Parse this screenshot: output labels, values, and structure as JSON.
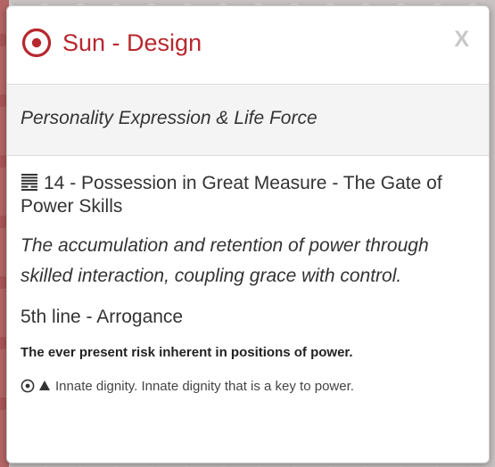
{
  "dialog": {
    "title": "Sun - Design",
    "close_label": "X",
    "subtitle": "Personality Expression & Life Force"
  },
  "gate": {
    "heading": "14 - Possession in Great Measure - The Gate of Power Skills",
    "description": "The accumulation and retention of power through skilled interaction, coupling grace with control."
  },
  "line": {
    "title": "5th line - Arrogance",
    "summary": "The ever present risk inherent in positions of power.",
    "detail": "Innate dignity. Innate dignity that is a key to power."
  },
  "icons": {
    "title_icon": "sun-icon",
    "gate_icon": "hexagram-icon",
    "detail_icon_1": "sun-icon",
    "detail_icon_2": "up-triangle-icon"
  },
  "colors": {
    "accent": "#b7282e",
    "close": "#c8c8c8",
    "text": "#333333",
    "subheader_bg": "#f4f4f4"
  }
}
